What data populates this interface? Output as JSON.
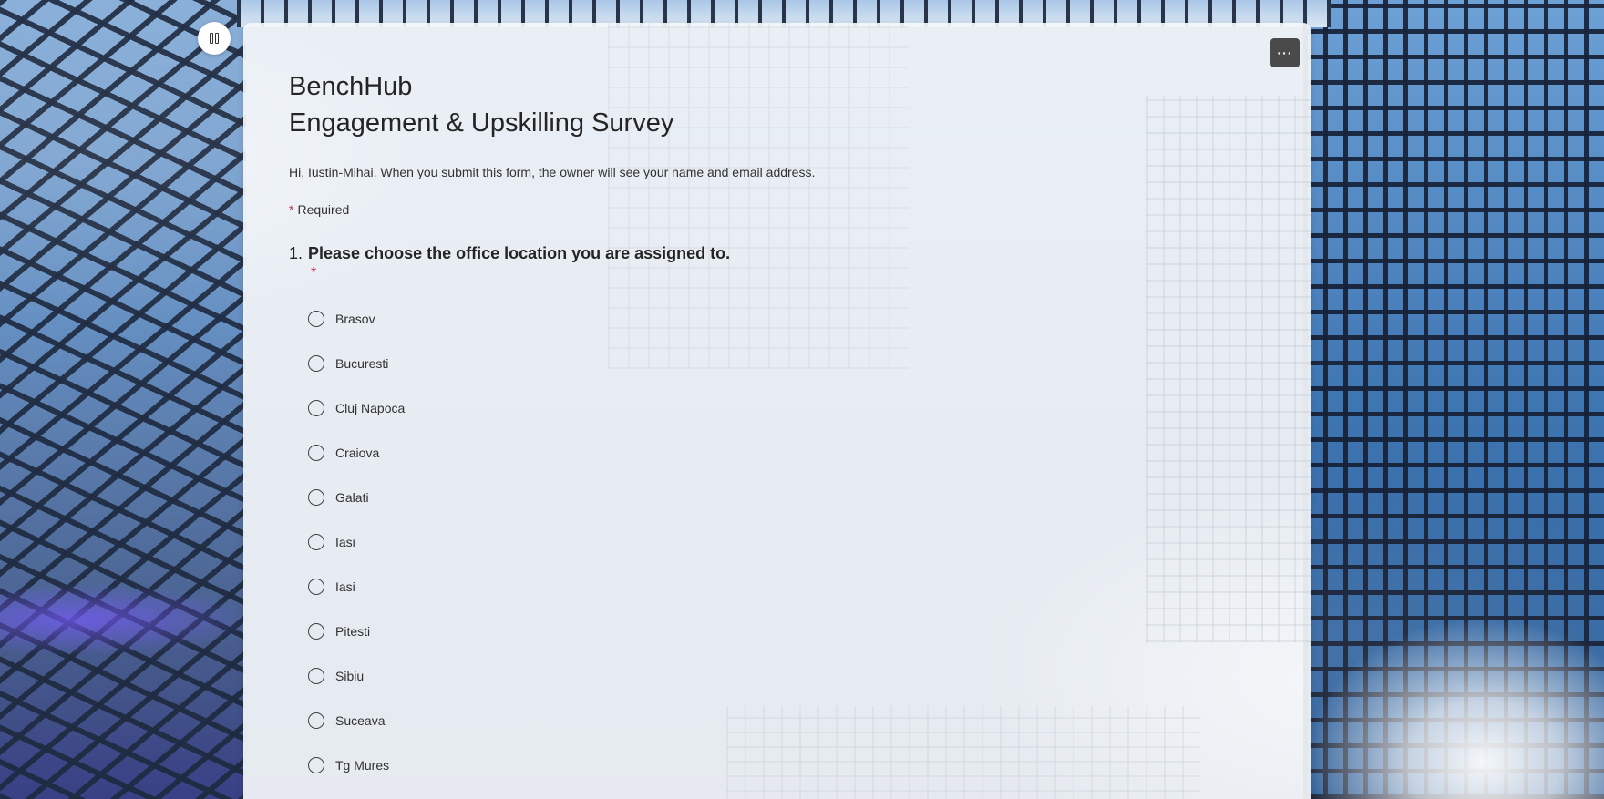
{
  "form": {
    "brand": "BenchHub",
    "title": "Engagement & Upskilling Survey",
    "greeting": "Hi, Iustin-Mihai. When you submit this form, the owner will see your name and email address.",
    "required_star": "*",
    "required_label": "Required"
  },
  "toolbar": {
    "more_label": "···",
    "pause_icon": "pause-icon"
  },
  "question1": {
    "number": "1.",
    "text": "Please choose the office location you are assigned to.",
    "star": "*",
    "options": [
      "Brasov",
      "Bucuresti",
      "Cluj Napoca",
      "Craiova",
      "Galati",
      "Iasi",
      "Iasi",
      "Pitesti",
      "Sibiu",
      "Suceava",
      "Tg Mures"
    ]
  },
  "colors": {
    "required_star": "#c4314b",
    "card_bg": "#f4f6f9",
    "more_button_bg": "#4a4a4a"
  }
}
